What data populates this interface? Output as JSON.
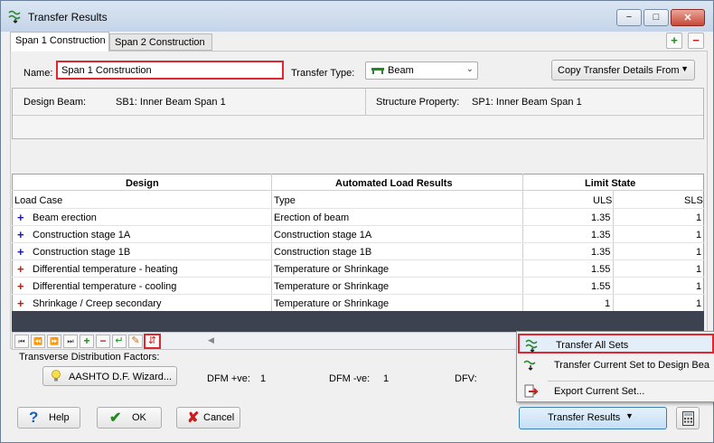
{
  "window": {
    "title": "Transfer Results",
    "min_glyph": "−",
    "max_glyph": "□",
    "close_glyph": "✕"
  },
  "tabs": [
    {
      "label": "Span 1 Construction"
    },
    {
      "label": "Span 2 Construction"
    }
  ],
  "tab_buttons": {
    "add_glyph": "+",
    "remove_glyph": "−",
    "add_color": "#1e8c1e",
    "remove_color": "#c81e1e"
  },
  "form": {
    "name_label": "Name:",
    "name_value": "Span 1 Construction",
    "transfer_type_label": "Transfer Type:",
    "transfer_type_value": "Beam",
    "copy_button_label": "Copy Transfer Details From",
    "copy_arrow": "▼",
    "select_chevron": "⌄"
  },
  "info": {
    "design_beam_label": "Design Beam:",
    "design_beam_value": "SB1: Inner Beam Span 1",
    "structure_property_label": "Structure Property:",
    "structure_property_value": "SP1: Inner Beam Span 1"
  },
  "grid": {
    "group_headers": {
      "design": "Design",
      "automated": "Automated Load Results",
      "limit_state": "Limit State"
    },
    "sub_headers": {
      "load_case": "Load Case",
      "type": "Type",
      "uls": "ULS",
      "sls": "SLS"
    },
    "rows": [
      {
        "glyph": "+",
        "glyph_color": "#1a1aa6",
        "load_case": "Beam erection",
        "type": "Erection of beam",
        "uls": "1.35",
        "sls": "1"
      },
      {
        "glyph": "+",
        "glyph_color": "#1a1aa6",
        "load_case": "Construction stage 1A",
        "type": "Construction stage 1A",
        "uls": "1.35",
        "sls": "1"
      },
      {
        "glyph": "+",
        "glyph_color": "#1a1aa6",
        "load_case": "Construction stage 1B",
        "type": "Construction stage 1B",
        "uls": "1.35",
        "sls": "1"
      },
      {
        "glyph": "+",
        "glyph_color": "#a62a1a",
        "load_case": "Differential temperature - heating",
        "type": "Temperature or Shrinkage",
        "uls": "1.55",
        "sls": "1"
      },
      {
        "glyph": "+",
        "glyph_color": "#a62a1a",
        "load_case": "Differential temperature - cooling",
        "type": "Temperature or Shrinkage",
        "uls": "1.55",
        "sls": "1"
      },
      {
        "glyph": "+",
        "glyph_color": "#a62a1a",
        "load_case": "Shrinkage / Creep secondary",
        "type": "Temperature or Shrinkage",
        "uls": "1",
        "sls": "1"
      }
    ]
  },
  "navigator": {
    "buttons": [
      {
        "name": "first-record-button",
        "glyph": "⏮"
      },
      {
        "name": "prior-page-button",
        "glyph": "⏪"
      },
      {
        "name": "next-page-button",
        "glyph": "⏩"
      },
      {
        "name": "last-record-button",
        "glyph": "⏭"
      },
      {
        "name": "insert-record-button",
        "glyph": "+"
      },
      {
        "name": "delete-record-button",
        "glyph": "−"
      },
      {
        "name": "append-record-button",
        "glyph": "↵"
      },
      {
        "name": "edit-record-button",
        "glyph": "✎"
      },
      {
        "name": "sort-order-button",
        "glyph": "⇵"
      }
    ],
    "scroll_left_glyph": "◀"
  },
  "distribution": {
    "label": "Transverse Distribution Factors:",
    "wizard_button": "AASHTO D.F.  Wizard...",
    "dfm_pos_label": "DFM +ve:",
    "dfm_pos_value": "1",
    "dfm_neg_label": "DFM -ve:",
    "dfm_neg_value": "1",
    "dfv_label": "DFV:"
  },
  "buttons": {
    "help": "Help",
    "ok": "OK",
    "cancel": "Cancel",
    "transfer_results": "Transfer Results",
    "transfer_results_arrow": "▼"
  },
  "menu": {
    "items": [
      {
        "label": "Transfer All Sets"
      },
      {
        "label": "Transfer Current Set to Design Bea"
      },
      {
        "label": "Export Current Set..."
      }
    ]
  },
  "colors": {
    "highlight": "#e0262e",
    "grid_dark": "#3c4250",
    "accent": "#3c7fb1"
  }
}
